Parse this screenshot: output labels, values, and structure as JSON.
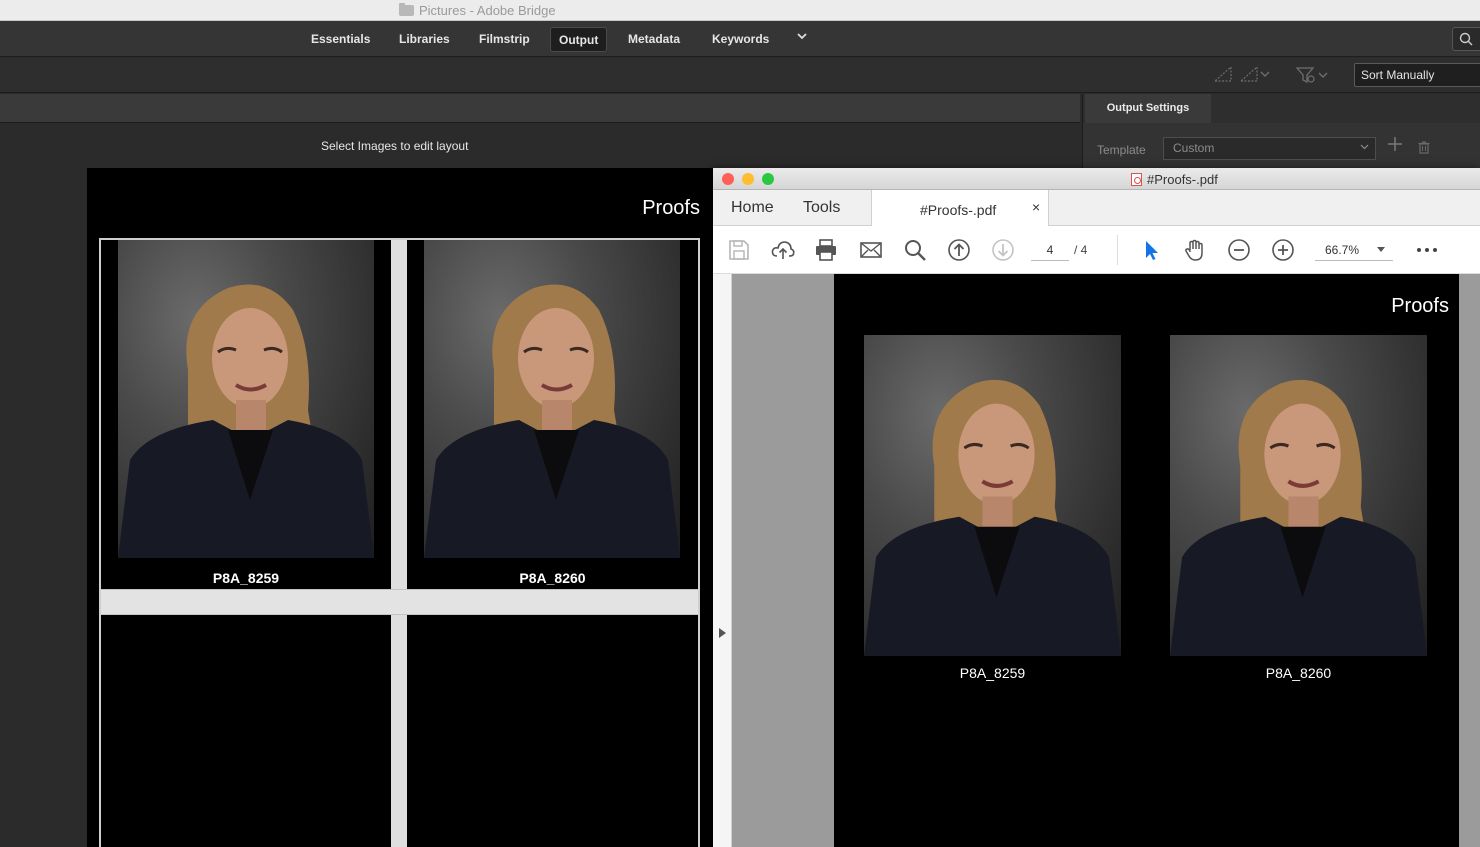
{
  "app": {
    "window_title": "Pictures - Adobe Bridge"
  },
  "workspace": {
    "tabs": [
      "Essentials",
      "Libraries",
      "Filmstrip",
      "Output",
      "Metadata",
      "Keywords"
    ],
    "active": "Output"
  },
  "toolbar": {
    "sort_label": "Sort Manually"
  },
  "output_panel": {
    "tab_label": "Output Settings",
    "template_label": "Template",
    "template_value": "Custom"
  },
  "content": {
    "hint": "Select Images to edit layout"
  },
  "bridge_preview": {
    "title": "Proofs",
    "captions": [
      "P8A_8259",
      "P8A_8260"
    ]
  },
  "acrobat": {
    "doc_title": "#Proofs-.pdf",
    "menu": {
      "home": "Home",
      "tools": "Tools"
    },
    "tab_name": "#Proofs-.pdf",
    "tab_close": "×",
    "page_current": "4",
    "page_of": "/ 4",
    "zoom": "66.7%",
    "page": {
      "title": "Proofs",
      "captions": [
        "P8A_8259",
        "P8A_8260"
      ]
    }
  },
  "colors": {
    "accent_blue": "#1473e6",
    "traffic_close": "#ff5f57",
    "traffic_min": "#febc2e",
    "traffic_max": "#28c840"
  }
}
